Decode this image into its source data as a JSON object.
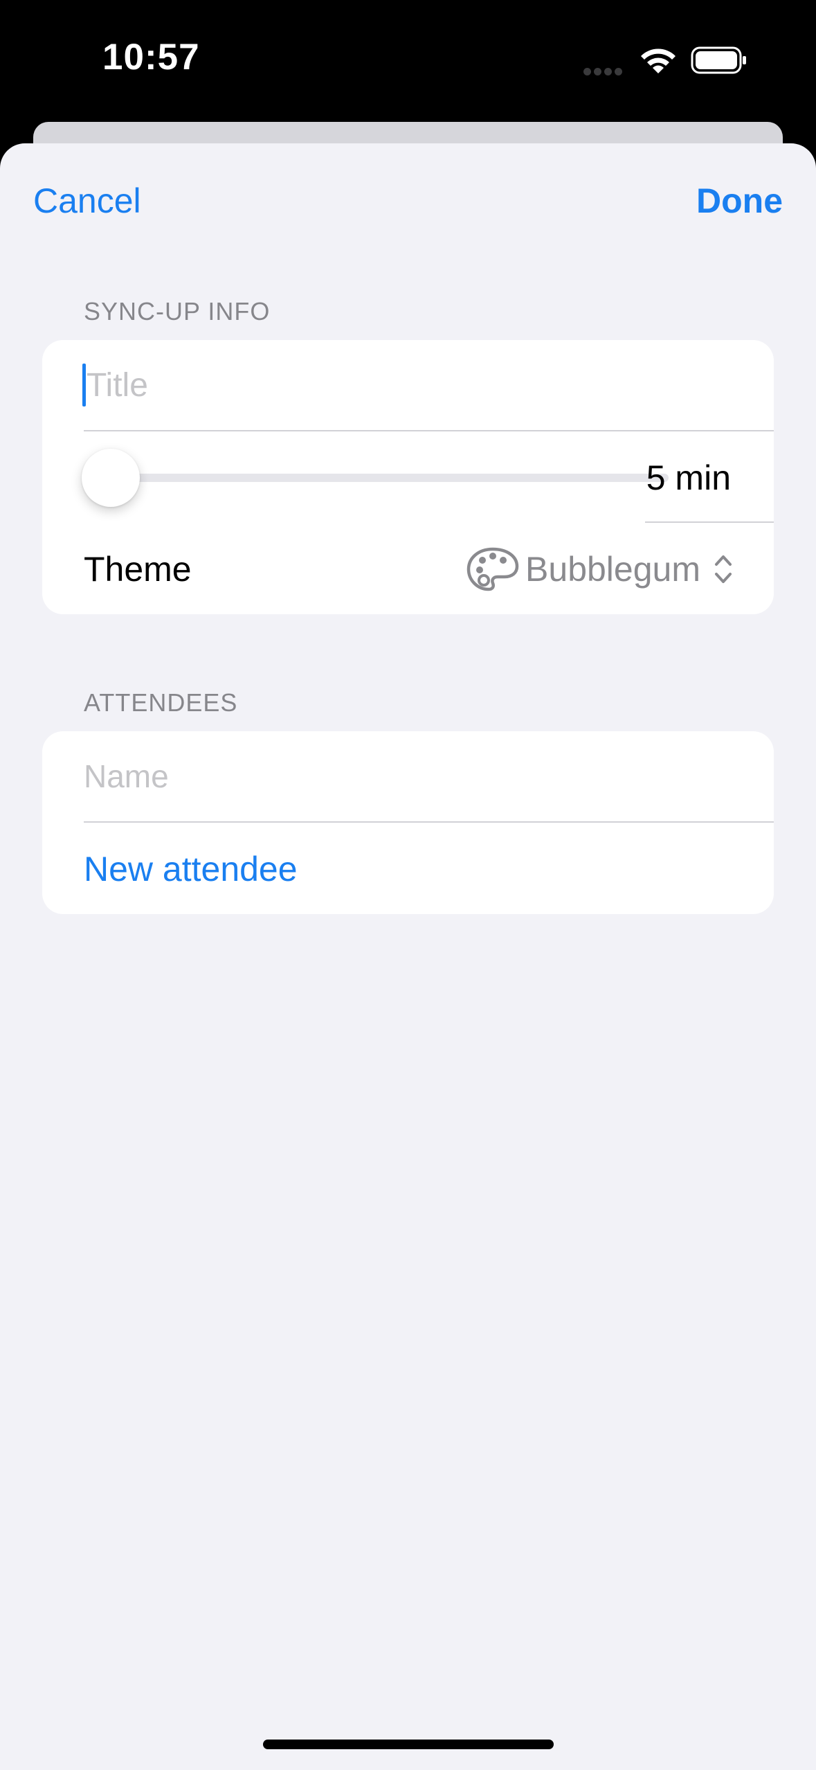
{
  "status_bar": {
    "time": "10:57",
    "icons": [
      "cellular-dots-icon",
      "wifi-icon",
      "battery-icon"
    ]
  },
  "nav": {
    "cancel_label": "Cancel",
    "done_label": "Done"
  },
  "sync_up_info": {
    "header": "SYNC-UP INFO",
    "title_placeholder": "Title",
    "title_value": "",
    "duration_label": "5 min",
    "duration_slider_fraction": 0,
    "theme_label": "Theme",
    "theme_icon": "palette-icon",
    "theme_value": "Bubblegum"
  },
  "attendees": {
    "header": "ATTENDEES",
    "name_placeholder": "Name",
    "new_attendee_label": "New attendee"
  },
  "colors": {
    "accent": "#1a7ff0",
    "background": "#f2f2f7",
    "card": "#ffffff",
    "secondary_text": "#86868b"
  }
}
